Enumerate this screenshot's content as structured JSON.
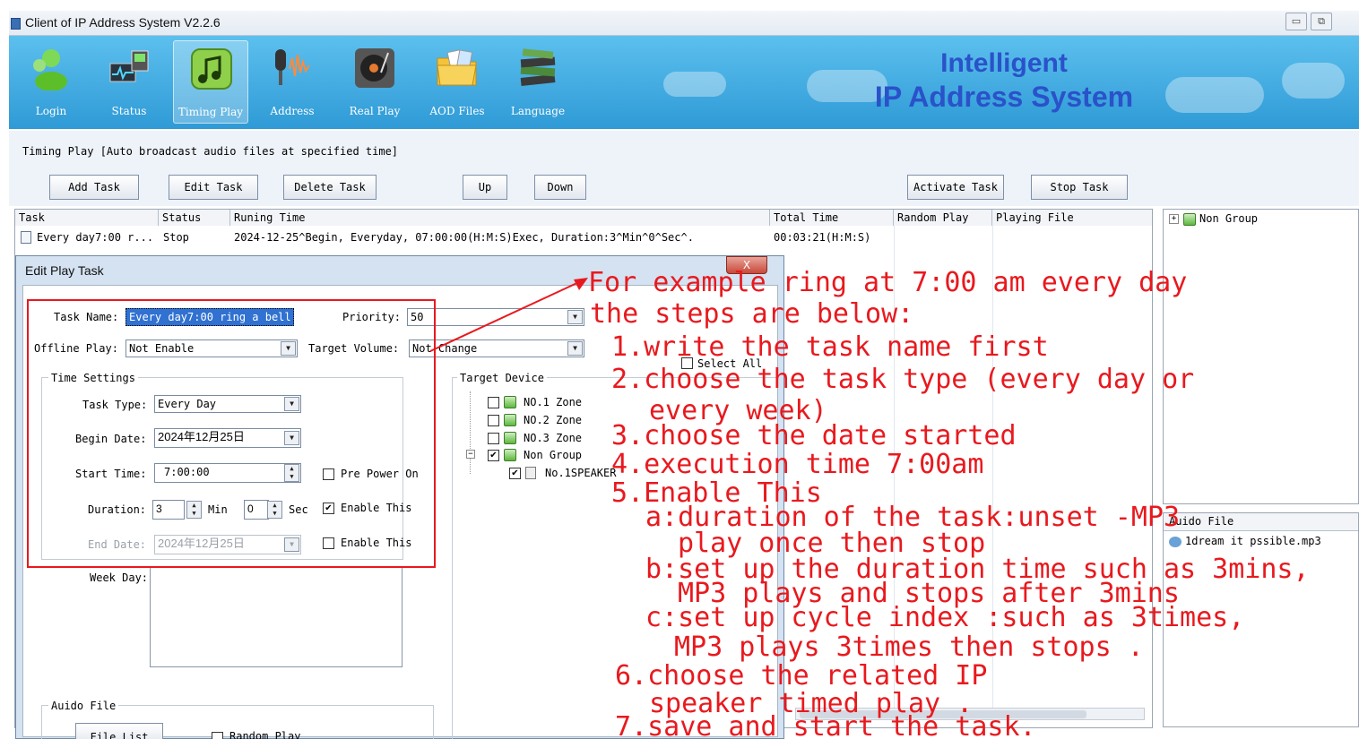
{
  "window": {
    "title": "Client of IP Address System V2.2.6"
  },
  "toolbar": {
    "items": [
      {
        "label": "Login",
        "icon": "users-icon"
      },
      {
        "label": "Status",
        "icon": "monitor-icon"
      },
      {
        "label": "Timing Play",
        "icon": "music-note-icon",
        "active": true
      },
      {
        "label": "Address",
        "icon": "microphone-icon"
      },
      {
        "label": "Real Play",
        "icon": "turntable-icon"
      },
      {
        "label": "AOD Files",
        "icon": "folder-icon"
      },
      {
        "label": "Language",
        "icon": "books-icon"
      }
    ]
  },
  "brand": {
    "line1": "Intelligent",
    "line2": "IP Address System",
    "color": "#2a52c9"
  },
  "info": {
    "text": "Timing Play  [Auto broadcast audio files at specified time]"
  },
  "buttons": {
    "add_task": "Add Task",
    "edit_task": "Edit Task",
    "delete_task": "Delete Task",
    "up": "Up",
    "down": "Down",
    "activate_task": "Activate Task",
    "stop_task": "Stop Task"
  },
  "table": {
    "headers": {
      "task": "Task",
      "status": "Status",
      "running_time": "Runing Time",
      "total_time": "Total Time",
      "random_play": "Random Play",
      "playing_file": "Playing File"
    },
    "rows": [
      {
        "task": "Every day7:00 r...",
        "status": "Stop",
        "running_time": "2024-12-25^Begin, Everyday, 07:00:00(H:M:S)Exec, Duration:3^Min^0^Sec^.",
        "total_time": "00:03:21(H:M:S)"
      }
    ]
  },
  "right_tree": {
    "root": "Non Group"
  },
  "audio_panel": {
    "header": "Auido File",
    "file": "1dream it pssible.mp3"
  },
  "dialog": {
    "title": "Edit Play Task",
    "close": "X",
    "task_name_label": "Task Name:",
    "task_name_value": "Every day7:00 ring a bell",
    "priority_label": "Priority:",
    "priority_value": "50",
    "offline_label": "Offline Play:",
    "offline_value": "Not Enable",
    "volume_label": "Target Volume:",
    "volume_value": "Not Change",
    "time_settings": "Time Settings",
    "task_type_label": "Task Type:",
    "task_type_value": "Every Day",
    "begin_date_label": "Begin Date:",
    "begin_date_value": "2024年12月25日",
    "start_time_label": "Start Time:",
    "start_time_value": "7:00:00",
    "pre_power_label": "Pre Power On",
    "duration_label": "Duration:",
    "duration_min": "3",
    "min_label": "Min",
    "duration_sec": "0",
    "sec_label": "Sec",
    "enable_this_1": "Enable This",
    "end_date_label": "End Date:",
    "end_date_value": "2024年12月25日",
    "enable_this_2": "Enable This",
    "week_day_label": "Week Day:",
    "target_device": "Target Device",
    "select_all": "Select All",
    "tree": [
      "NO.1 Zone",
      "NO.2 Zone",
      "NO.3 Zone",
      "Non Group",
      "No.1SPEAKER"
    ],
    "audio_group": "Auido File",
    "file_list": "File List",
    "random_play": "Random Play"
  },
  "annotation": {
    "color": "#e8191e",
    "lines": [
      "For example ring at 7:00 am every day",
      "the steps are below:",
      "1.write the task name first",
      "2.choose the task type (every day or",
      "every week)",
      "3.choose the date started",
      "4.execution time 7:00am",
      "5.Enable This",
      "a:duration of the task:unset -MP3",
      "play once then stop",
      "b:set up the duration time such as 3mins,",
      "MP3 plays and stops after 3mins",
      "c:set up cycle index :such as 3times,",
      "MP3 plays 3times then stops .",
      "6.choose the related IP",
      "speaker timed play .",
      "7.save and start the task."
    ]
  }
}
